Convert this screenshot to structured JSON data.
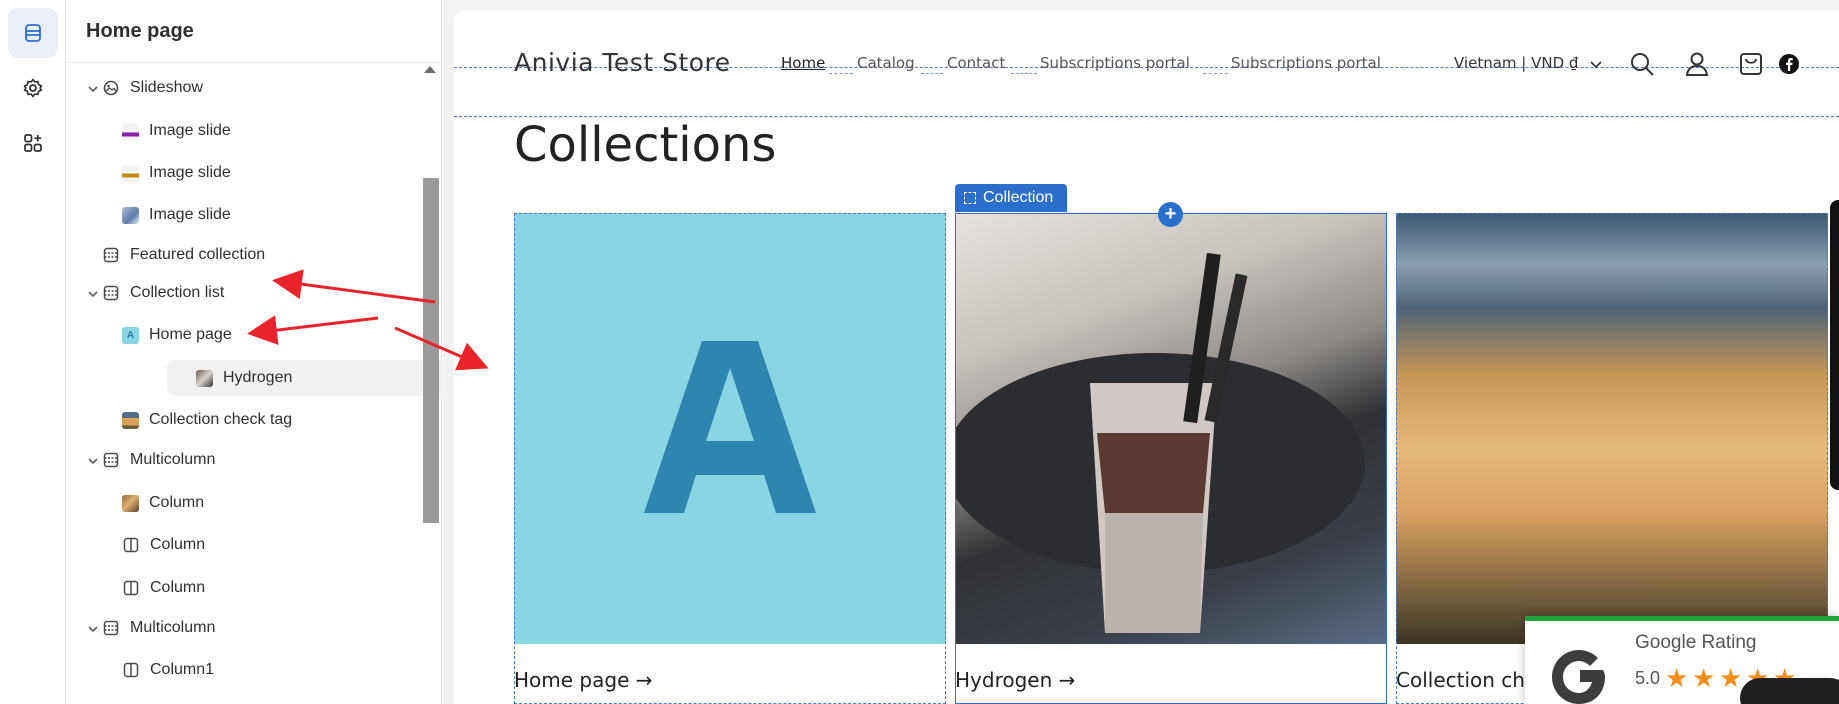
{
  "sidebar": {
    "title": "Home page",
    "items": [
      {
        "label": "Slideshow"
      },
      {
        "label": "Image slide"
      },
      {
        "label": "Image slide"
      },
      {
        "label": "Image slide"
      },
      {
        "label": "Featured collection"
      },
      {
        "label": "Collection list"
      },
      {
        "label": "Home page"
      },
      {
        "label": "Hydrogen"
      },
      {
        "label": "Collection check tag"
      },
      {
        "label": "Multicolumn"
      },
      {
        "label": "Column"
      },
      {
        "label": "Column"
      },
      {
        "label": "Column"
      },
      {
        "label": "Multicolumn"
      },
      {
        "label": "Column1"
      }
    ]
  },
  "store": {
    "name": "Anivia Test Store",
    "nav": [
      "Home",
      "Catalog",
      "Contact",
      "Subscriptions portal",
      "Subscriptions portal"
    ],
    "locale": "Vietnam | VND ₫"
  },
  "main": {
    "heading": "Collections",
    "selected_tag": "Collection",
    "cards": [
      {
        "label": "Home page",
        "arrow": "→"
      },
      {
        "label": "Hydrogen",
        "arrow": "→"
      },
      {
        "label": "Collection ch"
      }
    ]
  },
  "google_widget": {
    "title": "Google Rating",
    "score": "5.0",
    "stars": 5
  },
  "colors": {
    "accent": "#2c6ecb",
    "annotation_arrow": "#e8242a",
    "star": "#f28c1b",
    "widget_border": "#22a33a"
  }
}
